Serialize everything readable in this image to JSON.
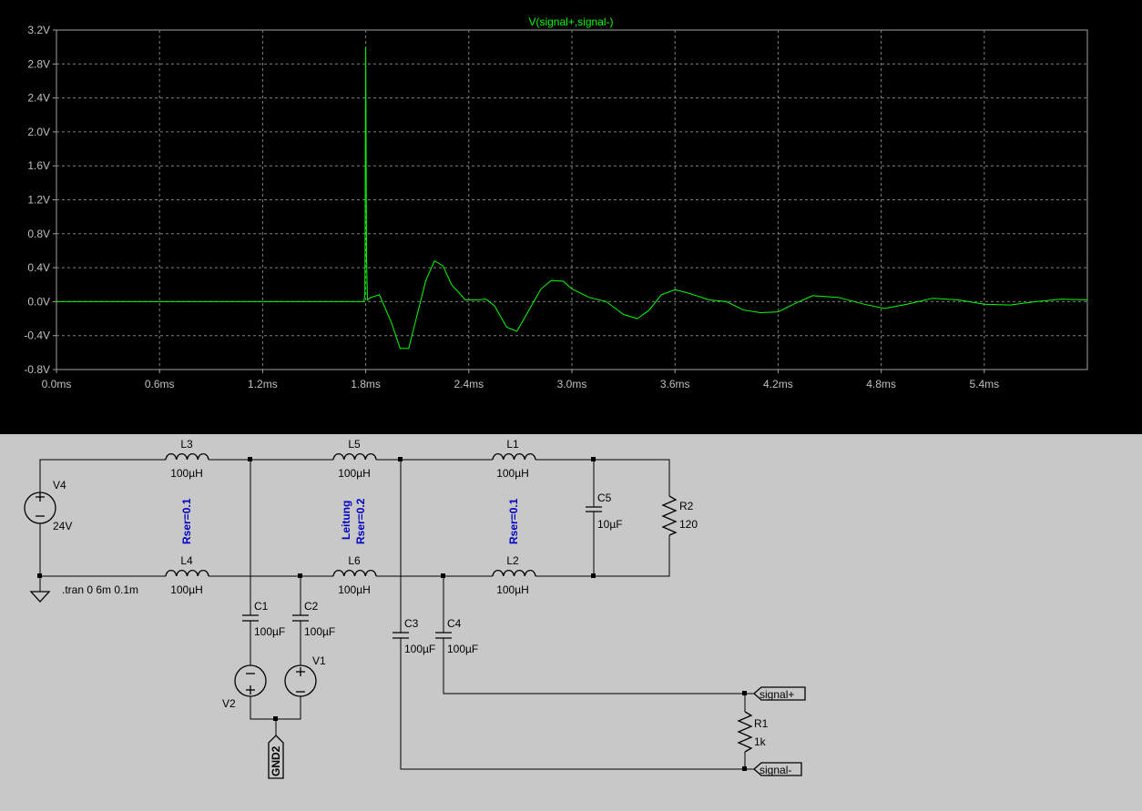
{
  "waveform": {
    "trace_name": "V(signal+,signal-)",
    "trace_color": "#00ff00",
    "background": "#000000",
    "y_ticks": [
      "3.2V",
      "2.8V",
      "2.4V",
      "2.0V",
      "1.6V",
      "1.2V",
      "0.8V",
      "0.4V",
      "0.0V",
      "-0.4V",
      "-0.8V"
    ],
    "x_ticks": [
      "0.0ms",
      "0.6ms",
      "1.2ms",
      "1.8ms",
      "2.4ms",
      "3.0ms",
      "3.6ms",
      "4.2ms",
      "4.8ms",
      "5.4ms"
    ]
  },
  "chart_data": {
    "type": "line",
    "title": "V(signal+,signal-)",
    "xlabel": "",
    "ylabel": "",
    "xlim": [
      0,
      6.0
    ],
    "ylim": [
      -0.8,
      3.2
    ],
    "grid": true,
    "x_unit": "ms",
    "y_unit": "V",
    "series": [
      {
        "name": "V(signal+,signal-)",
        "x": [
          0.0,
          1.79,
          1.795,
          1.8,
          1.805,
          1.81,
          1.83,
          1.88,
          1.95,
          2.0,
          2.05,
          2.1,
          2.15,
          2.2,
          2.25,
          2.3,
          2.38,
          2.45,
          2.5,
          2.55,
          2.62,
          2.68,
          2.75,
          2.82,
          2.88,
          2.95,
          3.0,
          3.1,
          3.2,
          3.3,
          3.38,
          3.45,
          3.52,
          3.6,
          3.68,
          3.8,
          3.9,
          4.0,
          4.1,
          4.2,
          4.3,
          4.4,
          4.55,
          4.7,
          4.82,
          4.95,
          5.1,
          5.25,
          5.4,
          5.55,
          5.7,
          5.85,
          6.0
        ],
        "y": [
          0.0,
          0.0,
          0.1,
          3.0,
          0.5,
          0.02,
          0.05,
          0.08,
          -0.25,
          -0.55,
          -0.55,
          -0.15,
          0.25,
          0.48,
          0.42,
          0.2,
          0.02,
          0.02,
          0.03,
          -0.05,
          -0.3,
          -0.35,
          -0.1,
          0.15,
          0.25,
          0.24,
          0.15,
          0.05,
          0.0,
          -0.15,
          -0.2,
          -0.1,
          0.08,
          0.14,
          0.1,
          0.02,
          0.0,
          -0.1,
          -0.13,
          -0.12,
          -0.02,
          0.07,
          0.05,
          -0.03,
          -0.08,
          -0.03,
          0.04,
          0.02,
          -0.03,
          -0.04,
          0.0,
          0.03,
          0.02
        ]
      }
    ]
  },
  "schematic": {
    "labels": {
      "L3": "L3",
      "L3_val": "100µH",
      "L5": "L5",
      "L5_val": "100µH",
      "L1": "L1",
      "L1_val": "100µH",
      "L4": "L4",
      "L4_val": "100µH",
      "L6": "L6",
      "L6_val": "100µH",
      "L2": "L2",
      "L2_val": "100µH",
      "V4": "V4",
      "V4_val": "24V",
      "C5": "C5",
      "C5_val": "10µF",
      "R2": "R2",
      "R2_val": "120",
      "C1": "C1",
      "C1_val": "100µF",
      "C2": "C2",
      "C2_val": "100µF",
      "C3": "C3",
      "C3_val": "100µF",
      "C4": "C4",
      "C4_val": "100µF",
      "V1": "V1",
      "V2": "V2",
      "R1": "R1",
      "R1_val": "1k",
      "rser1": "Rser=0.1",
      "leitung": "Leitung",
      "rser2": "Rser=0.2",
      "rser3": "Rser=0.1",
      "tran": ".tran 0 6m 0.1m",
      "gnd2": "GND2",
      "signal_plus": "signal+",
      "signal_minus": "signal-"
    }
  }
}
